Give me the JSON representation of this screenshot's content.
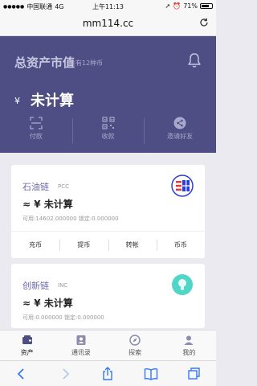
{
  "status_bar": {
    "carrier": "中国联通",
    "network": "4G",
    "time": "上午11:13",
    "battery_pct": "71%",
    "battery_level": 0.71
  },
  "browser": {
    "url": "mm114.cc"
  },
  "hero": {
    "title": "总资产市值",
    "subtitle": "共有12种币",
    "currency_symbol": "¥",
    "total_value": "未计算",
    "actions": [
      {
        "label": "付款",
        "icon": "scan-icon"
      },
      {
        "label": "收款",
        "icon": "qr-code-icon"
      },
      {
        "label": "邀请好友",
        "icon": "share-icon"
      }
    ]
  },
  "coins": [
    {
      "name": "石油链",
      "ticker": "PCC",
      "value": "≈ ¥ 未计算",
      "detail": "可用:14602.000000  锁定:0.000000",
      "logo_color": "#2b3fd6",
      "buttons": [
        "充币",
        "提币",
        "转帐",
        "币币"
      ]
    },
    {
      "name": "创新链",
      "ticker": "INC",
      "value": "≈ ¥ 未计算",
      "detail": "可用:0.000000  锁定:0.000000",
      "logo_color": "#4fd6c7"
    }
  ],
  "tabbar": {
    "items": [
      {
        "label": "资产",
        "icon": "wallet-icon",
        "active": true
      },
      {
        "label": "通讯录",
        "icon": "contacts-icon",
        "active": false
      },
      {
        "label": "探索",
        "icon": "explore-icon",
        "active": false
      },
      {
        "label": "我的",
        "icon": "profile-icon",
        "active": false
      }
    ]
  },
  "colors": {
    "hero_bg": "#4e4d84",
    "accent": "#6a69a8",
    "page_bg": "#ebeaf0"
  }
}
